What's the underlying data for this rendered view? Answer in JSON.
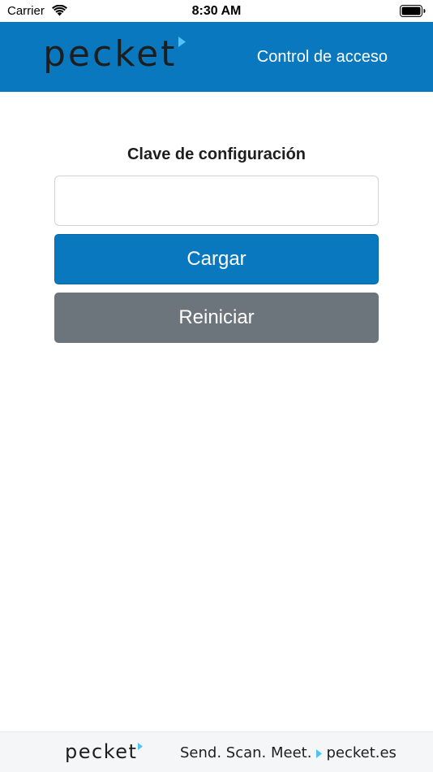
{
  "status_bar": {
    "carrier": "Carrier",
    "time": "8:30 AM",
    "icons": [
      "wifi-icon",
      "battery-icon"
    ]
  },
  "header": {
    "logo_text": "pecket",
    "title": "Control de acceso",
    "background_color": "#0a78be",
    "logo_accent_color": "#4fc3f7"
  },
  "form": {
    "label": "Clave de configuración",
    "input_value": "",
    "input_placeholder": "",
    "load_button": "Cargar",
    "reset_button": "Reiniciar",
    "load_button_color": "#0a78be",
    "reset_button_color": "#6d757c"
  },
  "footer": {
    "logo_text": "pecket",
    "tagline": "Send. Scan. Meet.",
    "website": "pecket.es"
  }
}
